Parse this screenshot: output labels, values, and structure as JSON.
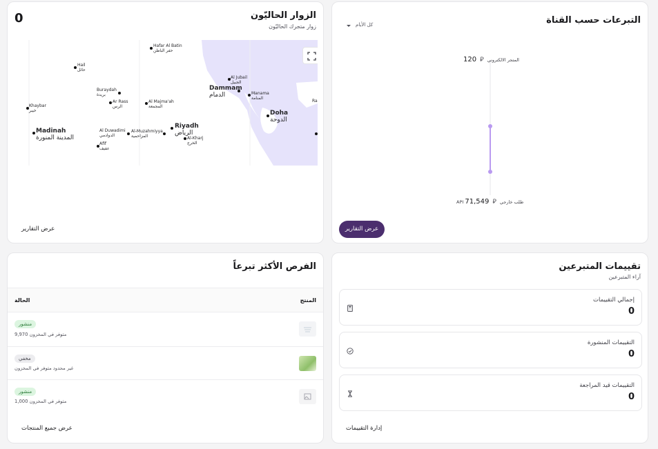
{
  "visitors": {
    "title": "الزوار الحاليّون",
    "subtitle": "زوار متجرك الحاليّون",
    "count": "0",
    "reports_link": "عرض التقارير",
    "cities": [
      {
        "name": "Hafar Al Batin",
        "ar": "حفر الباطن"
      },
      {
        "name": "Hail",
        "ar": "حائل"
      },
      {
        "name": "Buraydah",
        "ar": "بريدة"
      },
      {
        "name": "Ar Rass",
        "ar": "الرس"
      },
      {
        "name": "Al Majma'ah",
        "ar": "المجمعة"
      },
      {
        "name": "Khaybar",
        "ar": "خيبر"
      },
      {
        "name": "Madinah",
        "ar": "المدينة المنورة"
      },
      {
        "name": "Al Duwadimi",
        "ar": "الدوادمي"
      },
      {
        "name": "Al-Muzahmiyya",
        "ar": "المزاحمية"
      },
      {
        "name": "Riyadh",
        "ar": "الرياض"
      },
      {
        "name": "Al-Kharj",
        "ar": "الخرج"
      },
      {
        "name": "Afif",
        "ar": "عفيف"
      },
      {
        "name": "Al Jubail",
        "ar": "الجبيل"
      },
      {
        "name": "Dammam",
        "ar": "الدمام"
      },
      {
        "name": "Manama",
        "ar": "المنامة"
      },
      {
        "name": "Doha",
        "ar": "الدوحة"
      },
      {
        "name": "Ra",
        "ar": ""
      }
    ]
  },
  "channels": {
    "title": "التبرعات حسب القناة",
    "filter": "كل الأيام",
    "top_value": "120",
    "top_label": "المتجر الالكتروني",
    "bottom_value": "71,549",
    "bottom_label": "API طلب خارجي",
    "currency_symbol": "⃁",
    "reports_button": "عرض التقارير"
  },
  "opportunities": {
    "title": "الفرص الأكثر تبرعاً",
    "col_product": "المنتج",
    "col_status": "الحالة",
    "rows": [
      {
        "status": "منشور",
        "stock": "9,970 متوفر في المخزون"
      },
      {
        "status": "مخفي",
        "stock": "غير محدود متوفر في المخزون"
      },
      {
        "status": "منشور",
        "stock": "1,000 متوفر في المخزون"
      }
    ],
    "all_products_link": "عرض جميع المنتجات"
  },
  "reviews": {
    "title": "تقييمات المتبرعين",
    "subtitle": "آراء المتبرعين",
    "items": [
      {
        "label": "إجمالي التقييمات",
        "value": "0"
      },
      {
        "label": "التقييمات المنشورة",
        "value": "0"
      },
      {
        "label": "التقييمات قيد المراجعة",
        "value": "0"
      }
    ],
    "manage_link": "إدارة التقييمات"
  }
}
